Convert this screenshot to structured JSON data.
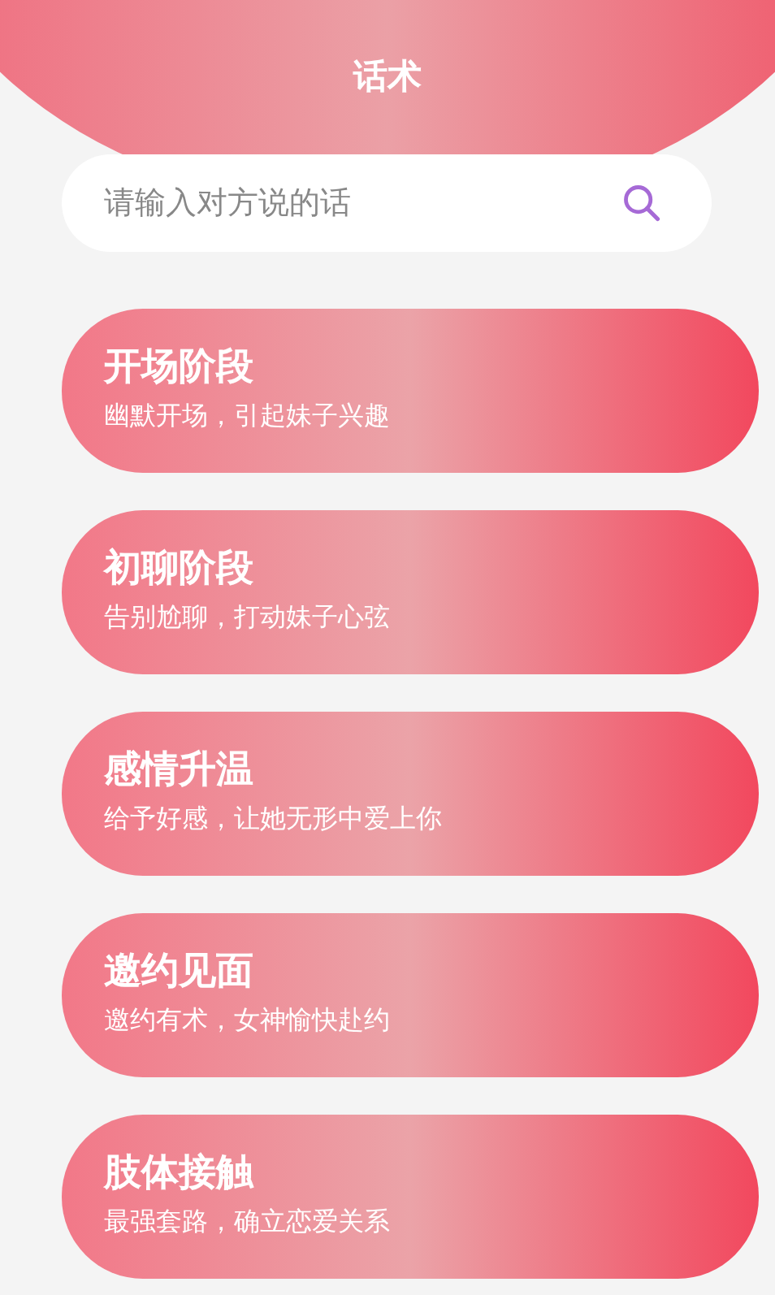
{
  "header": {
    "title": "话术"
  },
  "search": {
    "placeholder": "请输入对方说的话"
  },
  "stages": [
    {
      "title": "开场阶段",
      "subtitle": "幽默开场，引起妹子兴趣"
    },
    {
      "title": "初聊阶段",
      "subtitle": "告别尬聊，打动妹子心弦"
    },
    {
      "title": "感情升温",
      "subtitle": "给予好感，让她无形中爱上你"
    },
    {
      "title": "邀约见面",
      "subtitle": "邀约有术，女神愉快赴约"
    },
    {
      "title": "肢体接触",
      "subtitle": "最强套路，确立恋爱关系"
    }
  ]
}
